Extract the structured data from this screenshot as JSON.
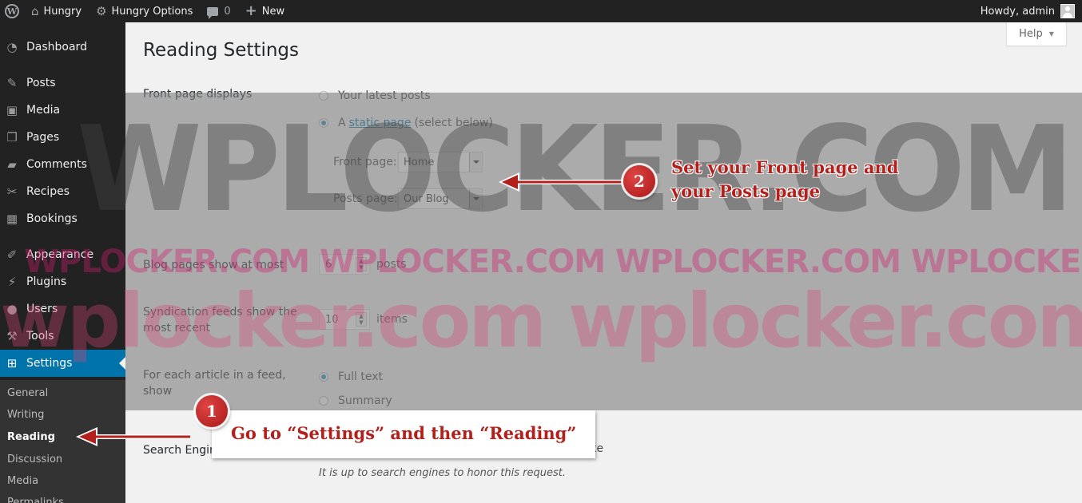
{
  "adminbar": {
    "site_name": "Hungry",
    "options_label": "Hungry Options",
    "comments_count": "0",
    "new_label": "New",
    "howdy": "Howdy, admin"
  },
  "sidebar": {
    "items": [
      {
        "label": "Dashboard",
        "icon": "dashboard-icon"
      },
      {
        "label": "Posts",
        "icon": "pin-icon"
      },
      {
        "label": "Media",
        "icon": "media-icon"
      },
      {
        "label": "Pages",
        "icon": "pages-icon"
      },
      {
        "label": "Comments",
        "icon": "comment-icon"
      },
      {
        "label": "Recipes",
        "icon": "recipes-icon"
      },
      {
        "label": "Bookings",
        "icon": "calendar-icon"
      },
      {
        "label": "Appearance",
        "icon": "brush-icon"
      },
      {
        "label": "Plugins",
        "icon": "plug-icon"
      },
      {
        "label": "Users",
        "icon": "user-icon"
      },
      {
        "label": "Tools",
        "icon": "wrench-icon"
      },
      {
        "label": "Settings",
        "icon": "settings-icon"
      }
    ],
    "submenu": [
      "General",
      "Writing",
      "Reading",
      "Discussion",
      "Media",
      "Permalinks"
    ],
    "active_submenu": "Reading"
  },
  "page": {
    "help_label": "Help",
    "title": "Reading Settings",
    "front_page_displays": {
      "label": "Front page displays",
      "option_latest": "Your latest posts",
      "option_static_prefix": "A",
      "option_static_link": "static page",
      "option_static_suffix": "(select below)",
      "selected": "static"
    },
    "front_page": {
      "label": "Front page:",
      "value": "Home"
    },
    "posts_page": {
      "label": "Posts page:",
      "value": "Our Blog"
    },
    "blog_pages": {
      "label": "Blog pages show at most",
      "value": "6",
      "unit": "posts"
    },
    "syndication": {
      "label_line1": "Syndication feeds show the",
      "label_line2": "most recent",
      "value": "10",
      "unit": "items"
    },
    "feed_article": {
      "label_line1": "For each article in a feed,",
      "label_line2": "show",
      "option_full": "Full text",
      "option_summary": "Summary",
      "selected": "full"
    },
    "search_engine": {
      "label": "Search Engin",
      "visible_tail": "te",
      "description": "It is up to search engines to honor this request."
    }
  },
  "annotations": {
    "step1_number": "1",
    "step1_text": "Go to “Settings” and then “Reading”",
    "step2_number": "2",
    "step2_line1": "Set your Front page and",
    "step2_line2": "your Posts page",
    "callout_color": "#b3201c"
  },
  "watermarks": {
    "big": "WPLOCKER.COM",
    "mid": "WPLOCKER.COM WPLOCKER.COM WPLOCKER.COM WPLOCKER.COM",
    "low": "wplocker.com wplocker.com"
  },
  "colors": {
    "adminbar_bg": "#222222",
    "sidebar_bg": "#222222",
    "active_menu": "#0073aa",
    "content_bg": "#f1f1f1"
  }
}
